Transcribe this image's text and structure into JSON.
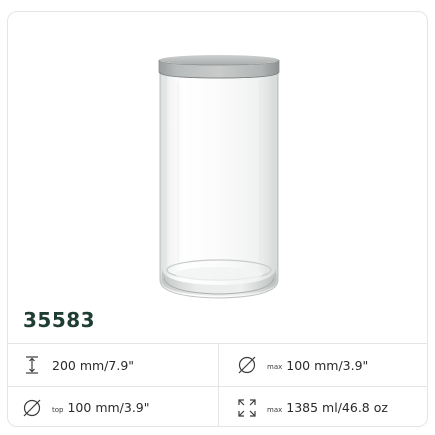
{
  "product": {
    "sku": "35583",
    "image_icon": "glass-jar-with-metal-lid"
  },
  "specs": {
    "height": {
      "icon": "height-icon",
      "value": "200 mm/7.9\""
    },
    "max_diameter": {
      "icon": "diameter-icon",
      "prefix": "max",
      "value": "100 mm/3.9\""
    },
    "top_diameter": {
      "icon": "diameter-icon",
      "prefix": "top",
      "value": "100 mm/3.9\""
    },
    "capacity": {
      "icon": "expand-icon",
      "prefix": "max",
      "value": "1385 ml/46.8 oz"
    }
  },
  "colors": {
    "border": "#e3e6e4",
    "sku_text": "#1f3d33",
    "icon_stroke": "#3c3c3c"
  }
}
